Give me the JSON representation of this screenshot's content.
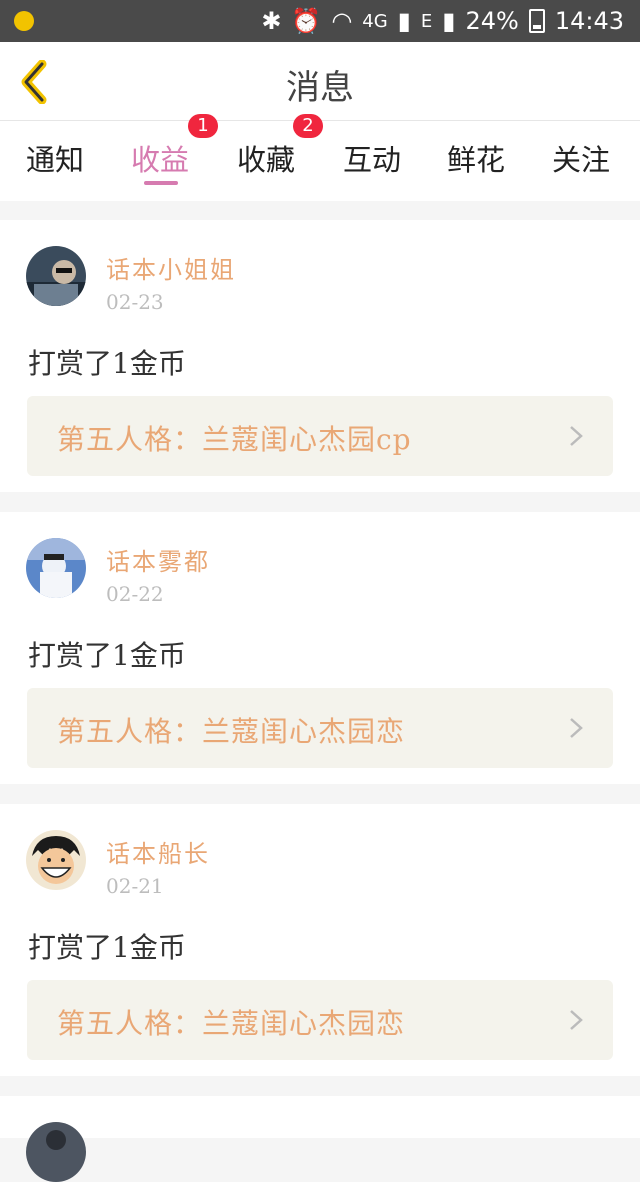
{
  "status": {
    "network": "4G",
    "network2": "E",
    "battery": "24%",
    "time": "14:43"
  },
  "header": {
    "title": "消息"
  },
  "tabs": [
    {
      "label": "通知",
      "badge": null
    },
    {
      "label": "收益",
      "badge": "1"
    },
    {
      "label": "收藏",
      "badge": "2"
    },
    {
      "label": "互动",
      "badge": null
    },
    {
      "label": "鲜花",
      "badge": null
    },
    {
      "label": "关注",
      "badge": null
    }
  ],
  "colors": {
    "accent": "#d67bb0",
    "name": "#e9a775",
    "badge": "#f0263e"
  },
  "messages": [
    {
      "user": "话本小姐姐",
      "date": "02-23",
      "text": "打赏了1金币",
      "work": "第五人格：兰蔻闺心杰园cp"
    },
    {
      "user": "话本雾都",
      "date": "02-22",
      "text": "打赏了1金币",
      "work": "第五人格：兰蔻闺心杰园恋"
    },
    {
      "user": "话本船长",
      "date": "02-21",
      "text": "打赏了1金币",
      "work": "第五人格：兰蔻闺心杰园恋"
    }
  ]
}
